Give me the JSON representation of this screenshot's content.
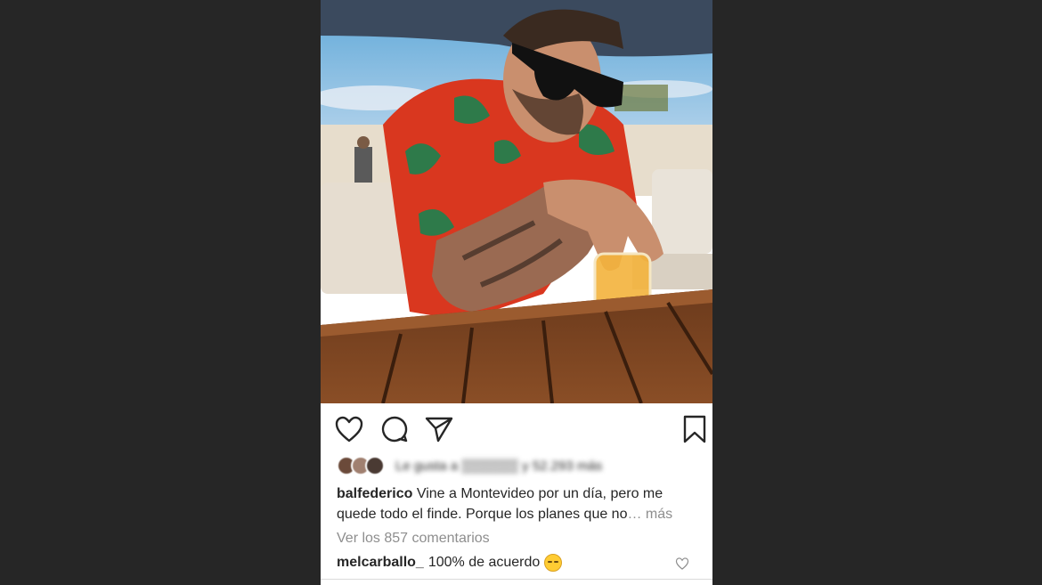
{
  "post": {
    "username": "balfederico",
    "caption_text": "Vine a Montevideo por un día, pero me quede todo el finde. Porque los planes que no",
    "more_label": "… más",
    "view_comments": "Ver los 857 comentarios",
    "likes_text": "Le gusta a ▒▒▒▒▒▒ y 52.293 más",
    "comment": {
      "username": "melcarballo_",
      "text": "100% de acuerdo"
    }
  },
  "icons": {
    "like": "heart-icon",
    "comment": "comment-bubble-icon",
    "share": "paper-plane-icon",
    "save": "bookmark-icon",
    "comment_like": "small-heart-icon",
    "comment_emoji": "relieved-face-emoji"
  },
  "colors": {
    "background": "#262626",
    "card": "#ffffff",
    "text": "#262626",
    "muted": "#8e8e8e"
  }
}
